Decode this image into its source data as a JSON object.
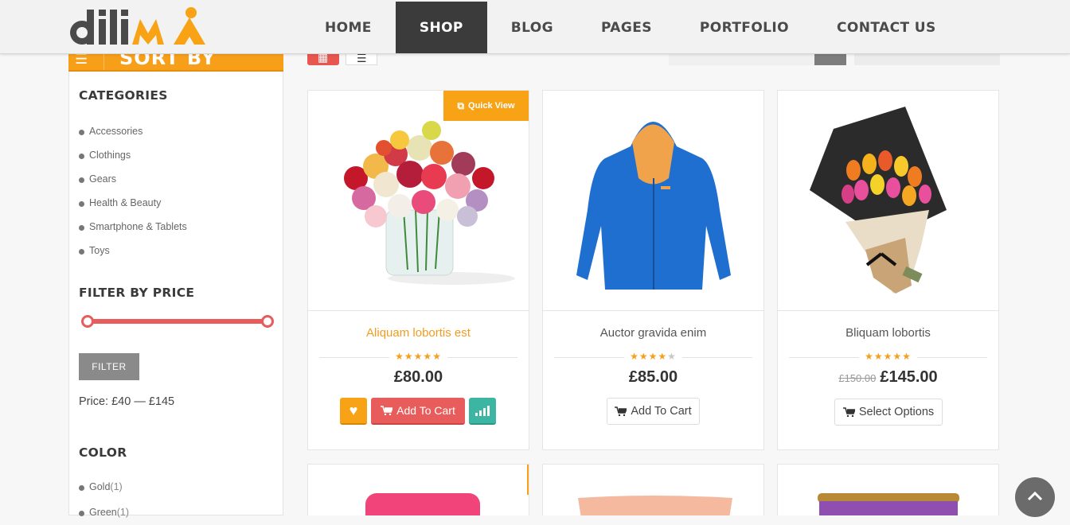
{
  "header": {
    "logo_text": "dilima",
    "nav": [
      {
        "label": "HOME",
        "active": false
      },
      {
        "label": "SHOP",
        "active": true
      },
      {
        "label": "BLOG",
        "active": false
      },
      {
        "label": "PAGES",
        "active": false
      },
      {
        "label": "PORTFOLIO",
        "active": false
      },
      {
        "label": "CONTACT US",
        "active": false
      }
    ]
  },
  "sidebar": {
    "sort_label": "SORT BY",
    "categories_heading": "CATEGORIES",
    "categories": [
      "Accessories",
      "Clothings",
      "Gears",
      "Health & Beauty",
      "Smartphone & Tablets",
      "Toys"
    ],
    "price_heading": "FILTER BY PRICE",
    "filter_button": "FILTER",
    "price_range": "Price: £40 — £145",
    "price_min": 40,
    "price_max": 145,
    "color_heading": "COLOR",
    "colors": [
      {
        "name": "Gold",
        "count": "(1)"
      },
      {
        "name": "Green",
        "count": "(1)"
      }
    ]
  },
  "products": [
    {
      "title": "Aliquam lobortis est",
      "rating": 5,
      "price": "£80.00",
      "old_price": "",
      "action": "Add To Cart",
      "quick_view": "Quick View",
      "image": "rose-bouquet-vase"
    },
    {
      "title": "Auctor gravida enim",
      "rating": 4,
      "price": "£85.00",
      "old_price": "",
      "action": "Add To Cart",
      "image": "blue-jacket"
    },
    {
      "title": "Bliquam lobortis",
      "rating": 5,
      "price": "£145.00",
      "old_price": "£150.00",
      "action": "Select Options",
      "image": "tulip-bouquet"
    }
  ],
  "colors": {
    "accent": "#f8a215",
    "red": "#e85c5c",
    "teal": "#3db5a3",
    "nav_active": "#3b3b3b"
  }
}
